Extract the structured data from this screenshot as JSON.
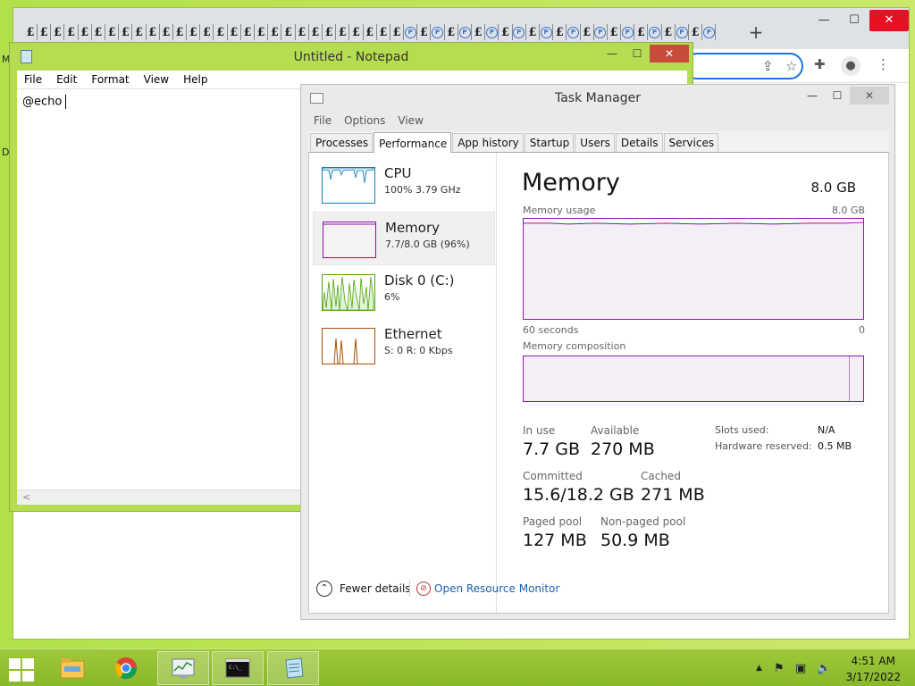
{
  "desktop": {
    "edge_letters": [
      "M",
      "D"
    ]
  },
  "chrome": {
    "tab_glyphs": [
      "£",
      "£",
      "£",
      "£",
      "£",
      "£",
      "£",
      "£",
      "£",
      "£",
      "£",
      "£",
      "£",
      "£",
      "£",
      "£",
      "£",
      "£",
      "£",
      "£",
      "£",
      "£",
      "£",
      "£",
      "£",
      "£",
      "£",
      "£",
      "£",
      "£",
      "£",
      "£",
      "£",
      "£",
      "£",
      "£",
      "£",
      "£",
      "£",
      "£",
      "£",
      "£",
      "£",
      "£",
      "£",
      "£",
      "£",
      "£",
      "£",
      "£",
      "£"
    ],
    "round_tab_glyph": "P",
    "new_tab_symbol": "+",
    "controls": {
      "minimize": "—",
      "maximize": "☐",
      "close": "✕"
    }
  },
  "notepad": {
    "title": "Untitled - Notepad",
    "menu": [
      "File",
      "Edit",
      "Format",
      "View",
      "Help"
    ],
    "content": "@echo",
    "controls": {
      "minimize": "—",
      "maximize": "☐",
      "close": "✕"
    },
    "hscroll_arrow": "<"
  },
  "taskmanager": {
    "title": "Task Manager",
    "menu": [
      "File",
      "Options",
      "View"
    ],
    "tabs": [
      "Processes",
      "Performance",
      "App history",
      "Startup",
      "Users",
      "Details",
      "Services"
    ],
    "active_tab": "Performance",
    "controls": {
      "minimize": "—",
      "maximize": "☐",
      "close": "✕"
    },
    "sidebar": [
      {
        "name": "CPU",
        "sub": "100%  3.79 GHz",
        "color": "#117dbb"
      },
      {
        "name": "Memory",
        "sub": "7.7/8.0 GB (96%)",
        "color": "#8b12ae"
      },
      {
        "name": "Disk 0 (C:)",
        "sub": "6%",
        "color": "#4da60c"
      },
      {
        "name": "Ethernet",
        "sub": "S: 0  R: 0 Kbps",
        "color": "#a74f01"
      }
    ],
    "main": {
      "heading": "Memory",
      "total": "8.0 GB",
      "usage_label": "Memory usage",
      "usage_max": "8.0 GB",
      "graph_left": "60 seconds",
      "graph_right": "0",
      "composition_label": "Memory composition",
      "usage_fraction": 0.96,
      "stats": {
        "in_use_label": "In use",
        "in_use": "7.7 GB",
        "available_label": "Available",
        "available": "270 MB",
        "committed_label": "Committed",
        "committed": "15.6/18.2 GB",
        "cached_label": "Cached",
        "cached": "271 MB",
        "paged_label": "Paged pool",
        "paged": "127 MB",
        "nonpaged_label": "Non-paged pool",
        "nonpaged": "50.9 MB",
        "slots_label": "Slots used:",
        "slots": "N/A",
        "hwres_label": "Hardware reserved:",
        "hwres": "0.5 MB"
      }
    },
    "footer": {
      "fewer_details": "Fewer details",
      "open_resource_monitor": "Open Resource Monitor"
    }
  },
  "taskbar": {
    "clock_time": "4:51 AM",
    "clock_date": "3/17/2022",
    "tray_chevron": "▲"
  }
}
